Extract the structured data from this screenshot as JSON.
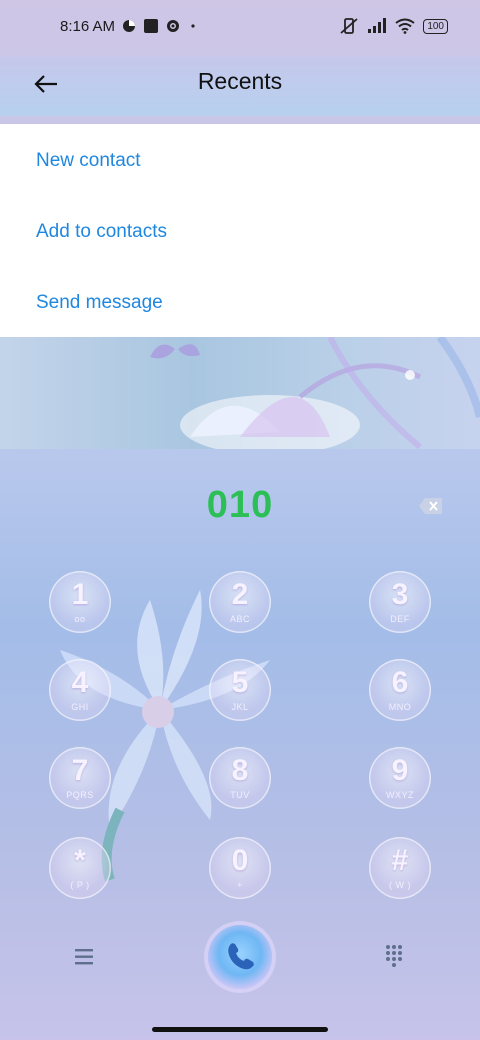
{
  "status": {
    "time": "8:16 AM",
    "battery": "100"
  },
  "header": {
    "title": "Recents"
  },
  "menu": {
    "items": [
      "New contact",
      "Add to contacts",
      "Send message"
    ]
  },
  "dialer": {
    "number": "010"
  },
  "keys": [
    {
      "digit": "1",
      "letters": "ᴏᴏ"
    },
    {
      "digit": "2",
      "letters": "ABC"
    },
    {
      "digit": "3",
      "letters": "DEF"
    },
    {
      "digit": "4",
      "letters": "GHI"
    },
    {
      "digit": "5",
      "letters": "JKL"
    },
    {
      "digit": "6",
      "letters": "MNO"
    },
    {
      "digit": "7",
      "letters": "PQRS"
    },
    {
      "digit": "8",
      "letters": "TUV"
    },
    {
      "digit": "9",
      "letters": "WXYZ"
    },
    {
      "digit": "*",
      "letters": "( P )"
    },
    {
      "digit": "0",
      "letters": "+"
    },
    {
      "digit": "#",
      "letters": "( W )"
    }
  ],
  "colors": {
    "link": "#1f87e0",
    "number": "#2bbf55"
  }
}
